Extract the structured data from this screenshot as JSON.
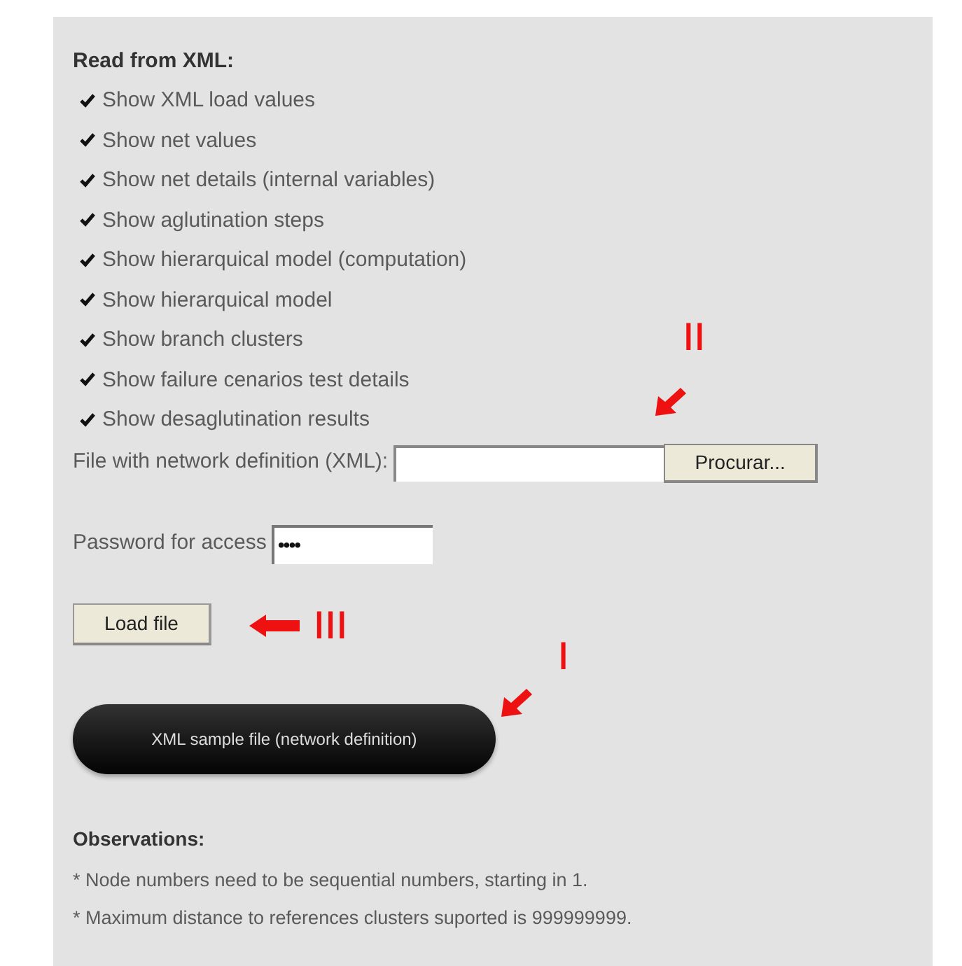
{
  "heading": "Read from XML:",
  "options": [
    {
      "label": "Show XML load values",
      "checked": true
    },
    {
      "label": "Show net values",
      "checked": true
    },
    {
      "label": "Show net details (internal variables)",
      "checked": true
    },
    {
      "label": "Show aglutination steps",
      "checked": true
    },
    {
      "label": "Show hierarquical model (computation)",
      "checked": true
    },
    {
      "label": "Show hierarquical model",
      "checked": true
    },
    {
      "label": "Show branch clusters",
      "checked": true
    },
    {
      "label": "Show failure cenarios test details",
      "checked": true
    },
    {
      "label": "Show desaglutination results",
      "checked": true
    }
  ],
  "file_field": {
    "label": "File with network definition (XML):",
    "button": "Procurar..."
  },
  "password_field": {
    "label": "Password for access",
    "value": "••••"
  },
  "load_button": "Load file",
  "sample_button": "XML sample file (network definition)",
  "observations": {
    "title": "Observations:",
    "notes": [
      "* Node numbers need to be sequential numbers, starting in 1.",
      "* Maximum distance to references clusters suported is 999999999."
    ]
  },
  "annotations": [
    {
      "label": "II"
    },
    {
      "label": "III"
    },
    {
      "label": "I"
    }
  ]
}
